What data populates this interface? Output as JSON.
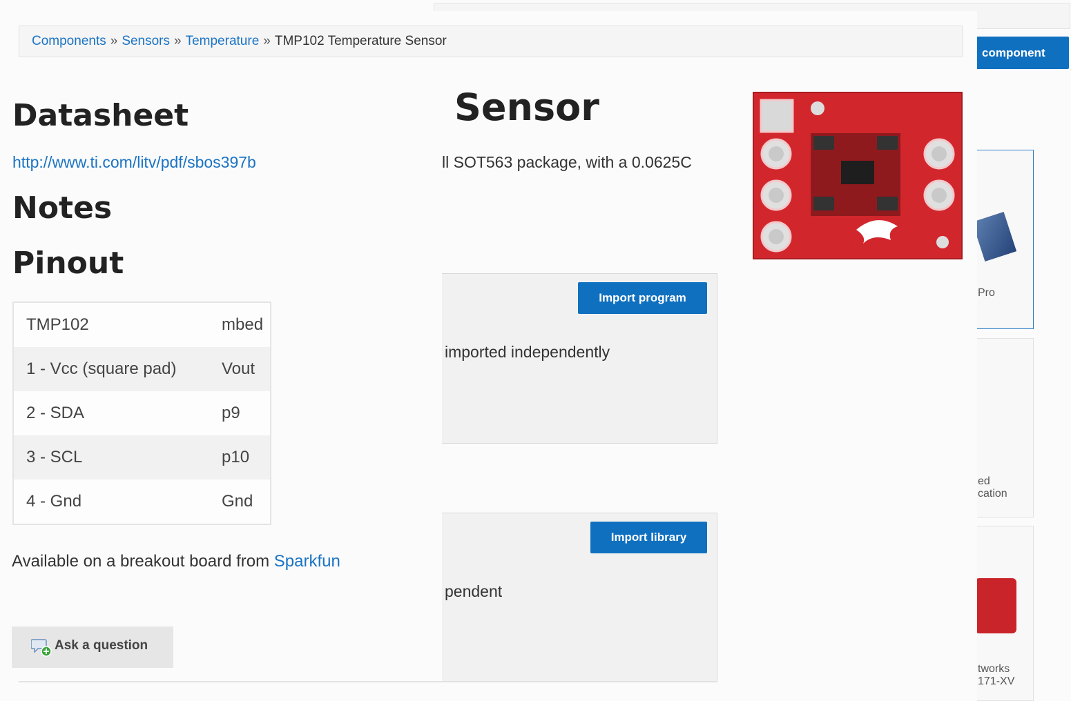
{
  "background": {
    "add_component_label": "component",
    "cards": [
      {
        "caption": "Pro"
      },
      {
        "caption": "ed\ncation"
      },
      {
        "caption": "tworks\n171-XV"
      }
    ]
  },
  "breadcrumb": {
    "items": [
      "Components",
      "Sensors",
      "Temperature"
    ],
    "separator": "»",
    "current": "TMP102 Temperature Sensor"
  },
  "page_title": "Sensor",
  "description": "ll SOT563 package, with a 0.0625C",
  "sections": {
    "datasheet_heading": "Datasheet",
    "datasheet_link": "http://www.ti.com/litv/pdf/sbos397b",
    "notes_heading": "Notes",
    "pinout_heading": "Pinout"
  },
  "pinout_table": {
    "rows": [
      [
        "TMP102",
        "mbed"
      ],
      [
        "1 - Vcc (square pad)",
        "Vout"
      ],
      [
        "2 - SDA",
        "p9"
      ],
      [
        "3 - SCL",
        "p10"
      ],
      [
        "4 - Gnd",
        "Gnd"
      ]
    ]
  },
  "availability": {
    "text": "Available on a breakout board from",
    "link": "Sparkfun"
  },
  "ask_button": "Ask a question",
  "program_panel": {
    "button": "Import program",
    "text": "imported independently"
  },
  "library_panel": {
    "button": "Import library",
    "text": "pendent"
  },
  "colors": {
    "link": "#1a73c4",
    "primary_button": "#1070c0",
    "board_red": "#d2262d"
  }
}
